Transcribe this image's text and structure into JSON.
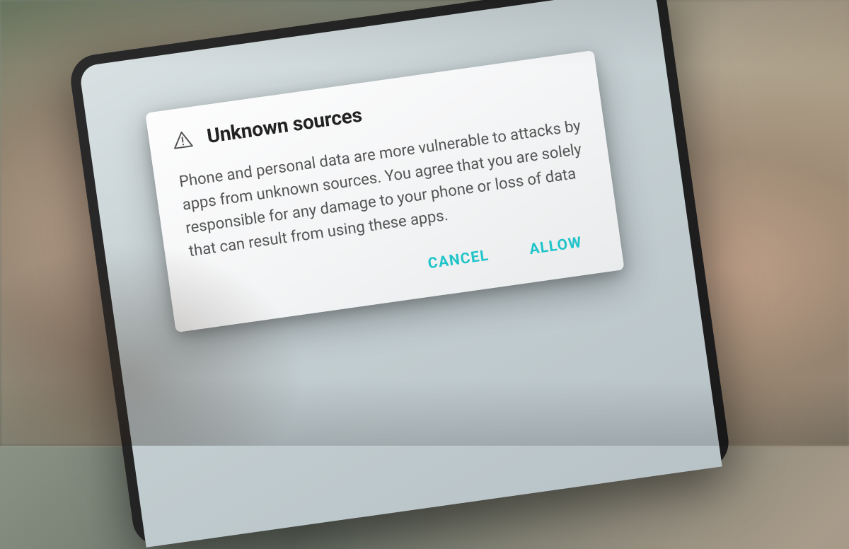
{
  "dialog": {
    "title": "Unknown sources",
    "body": "Phone and personal data are more vulnerable to attacks by apps from unknown sources. You agree that you are solely responsible for any damage to your phone or loss of data that can result from using these apps.",
    "cancel_label": "CANCEL",
    "allow_label": "ALLOW",
    "icon": "warning-triangle-icon",
    "colors": {
      "accent": "#1fc4c9",
      "title_text": "#222222",
      "body_text": "#555555",
      "dialog_bg": "#f8f8f8"
    }
  }
}
